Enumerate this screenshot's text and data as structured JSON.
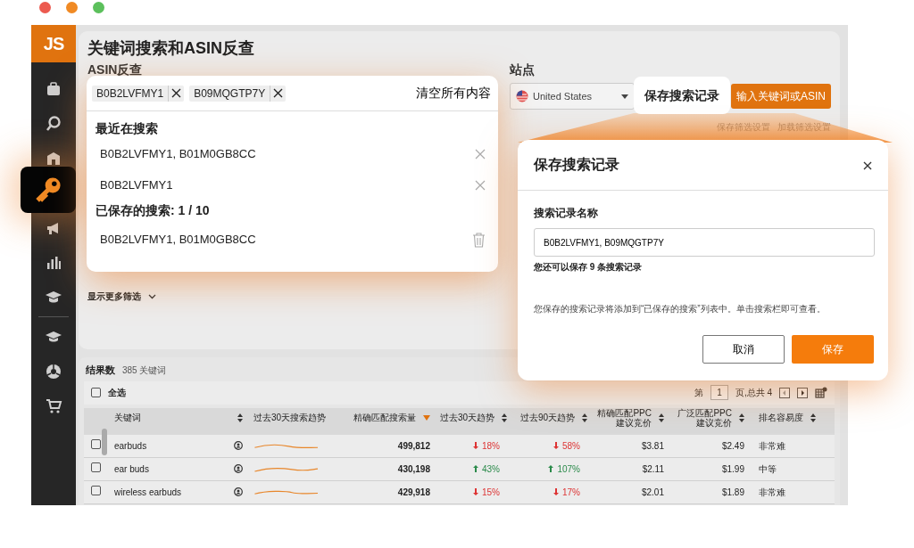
{
  "window_controls": [
    {
      "color": "#ec5a4f"
    },
    {
      "color": "#f08a24"
    },
    {
      "color": "#5cc05c"
    }
  ],
  "sidebar": {
    "logo": "JS",
    "items": [
      {
        "selected": false
      },
      {
        "selected": false
      },
      {
        "selected": false
      },
      {
        "selected": true
      },
      {
        "selected": false
      },
      {
        "selected": false
      },
      {
        "selected": false
      },
      {
        "selected": false
      },
      {
        "selected": false
      },
      {
        "selected": false
      }
    ]
  },
  "page": {
    "title": "关键词搜索和ASIN反查",
    "asin_label": "ASIN反查",
    "marketplace_label": "站点",
    "marketplace": "United States",
    "search_button": "输入关键词或ASIN",
    "filter_links": [
      "保存筛选设置",
      "加载筛选设置"
    ],
    "more_filters": "显示更多筛选"
  },
  "results": {
    "label": "结果数",
    "count": "385 关键词",
    "select_all": {
      "label": "全选",
      "checked": false
    },
    "pagination": {
      "prefix": "第",
      "page": "1",
      "suffix": "页,总共 4"
    },
    "columns": [
      {
        "label": "关键词",
        "sorted": false
      },
      {
        "label": "过去30天搜索趋势"
      },
      {
        "label": "精确匹配搜索量",
        "sorted": true
      },
      {
        "label": "过去30天趋势",
        "sorted": false
      },
      {
        "label": "过去90天趋势",
        "sorted": false
      },
      {
        "label": "精确匹配PPC建议竞价",
        "sorted": false
      },
      {
        "label": "广泛匹配PPC建议竞价",
        "sorted": false
      },
      {
        "label": "排名容易度",
        "sorted": false
      }
    ],
    "rows": [
      {
        "checked": false,
        "keyword": "earbuds",
        "volume": "499,812",
        "trend_30": {
          "value": "18%",
          "rising": false
        },
        "trend_90": {
          "value": "58%",
          "rising": false
        },
        "exact_bid": "$3.81",
        "broad_bid": "$2.49",
        "difficulty": "非常难"
      },
      {
        "checked": false,
        "keyword": "ear buds",
        "volume": "430,198",
        "trend_30": {
          "value": "43%",
          "rising": true
        },
        "trend_90": {
          "value": "107%",
          "rising": true
        },
        "exact_bid": "$2.11",
        "broad_bid": "$1.99",
        "difficulty": "中等"
      },
      {
        "checked": false,
        "keyword": "wireless earbuds",
        "volume": "429,918",
        "trend_30": {
          "value": "15%",
          "rising": false
        },
        "trend_90": {
          "value": "17%",
          "rising": false
        },
        "exact_bid": "$2.01",
        "broad_bid": "$1.89",
        "difficulty": "非常难"
      }
    ]
  },
  "search_popup": {
    "tags": [
      "B0B2LVFMY1",
      "B09MQGTP7Y"
    ],
    "clear_all": "清空所有内容",
    "recent_heading": "最近在搜索",
    "recent": [
      "B0B2LVFMY1, B01M0GB8CC",
      "B0B2LVFMY1"
    ],
    "saved_heading": "已保存的搜索: 1 / 10",
    "saved": [
      "B0B2LVFMY1, B01M0GB8CC"
    ]
  },
  "callout": {
    "label": "保存搜索记录"
  },
  "save_dialog": {
    "title": "保存搜索记录",
    "name_label": "搜索记录名称",
    "name_value": "B0B2LVFMY1, B09MQGTP7Y",
    "remaining": "您还可以保存 9 条搜索记录",
    "info": "您保存的搜索记录将添加到“已保存的搜索”列表中。单击搜索栏即可查看。",
    "cancel": "取消",
    "save": "保存"
  }
}
